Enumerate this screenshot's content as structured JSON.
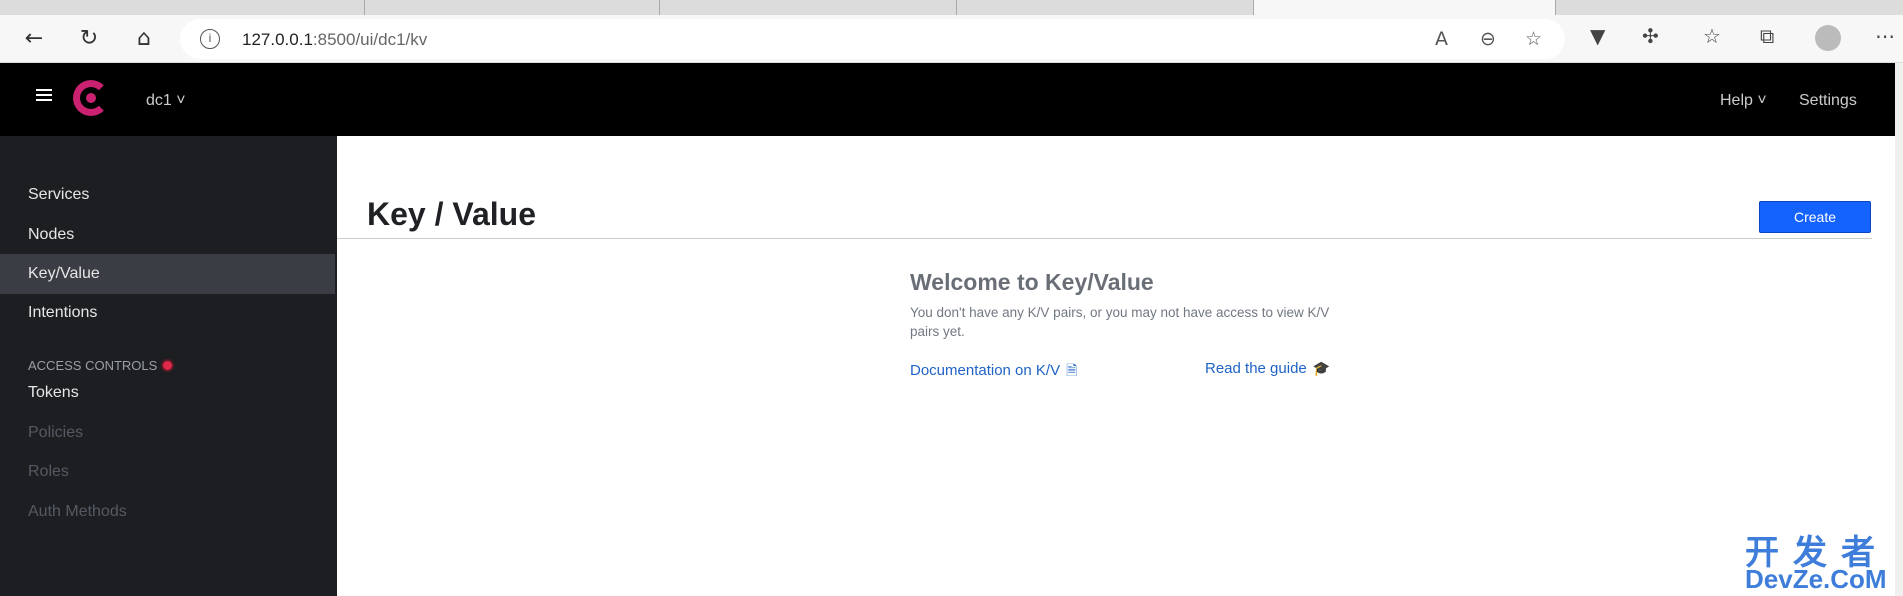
{
  "browser": {
    "url_host": "127.0.0.1",
    "url_rest": ":8500/ui/dc1/kv"
  },
  "header": {
    "datacenter": "dc1",
    "help": "Help",
    "settings": "Settings"
  },
  "sidebar": {
    "items": [
      {
        "label": "Services"
      },
      {
        "label": "Nodes"
      },
      {
        "label": "Key/Value"
      },
      {
        "label": "Intentions"
      }
    ],
    "section_heading": "ACCESS CONTROLS",
    "acl_items": [
      {
        "label": "Tokens"
      },
      {
        "label": "Policies"
      },
      {
        "label": "Roles"
      },
      {
        "label": "Auth Methods"
      }
    ]
  },
  "main": {
    "title": "Key / Value",
    "create_label": "Create",
    "empty": {
      "heading": "Welcome to Key/Value",
      "body": "You don't have any K/V pairs, or you may not have access to view K/V pairs yet.",
      "doc_link": "Documentation on K/V",
      "guide_link": "Read the guide"
    }
  },
  "watermark": {
    "line1": "开发者",
    "line2": "DevZe.CoM"
  },
  "colors": {
    "brand": "#ca2171",
    "primary": "#1563ff",
    "link": "#1f63c6"
  }
}
